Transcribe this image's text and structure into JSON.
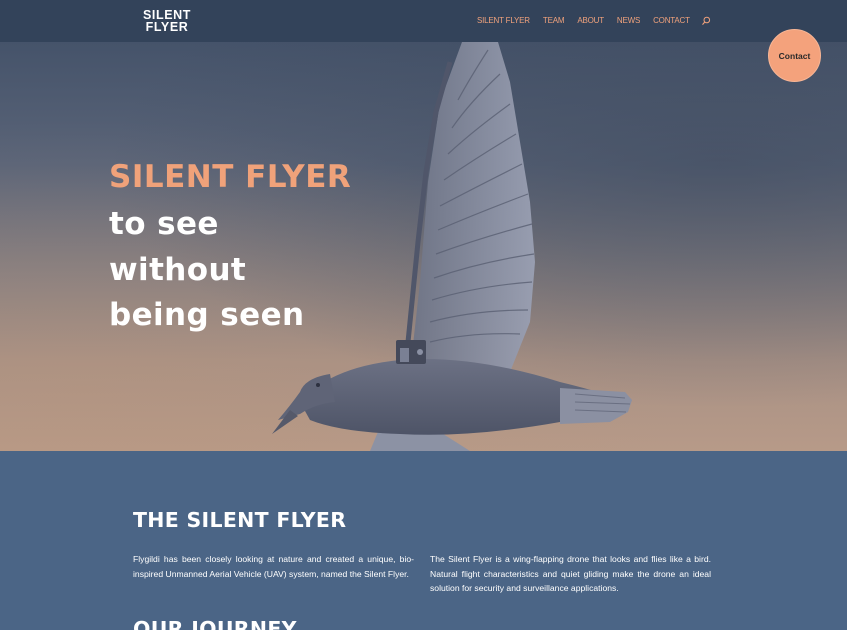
{
  "header": {
    "logo_line1": "SILENT",
    "logo_line2": "FLYER",
    "nav": [
      "SILENT FLYER",
      "TEAM",
      "ABOUT",
      "NEWS",
      "CONTACT"
    ],
    "search_icon": "search-icon"
  },
  "contact_button": {
    "label": "Contact",
    "color": "#f4a27c"
  },
  "hero": {
    "title_accent": "SILENT FLYER",
    "line1": "to see",
    "line2": "without",
    "line3": "being seen",
    "accent_color": "#f0a27a"
  },
  "section": {
    "title": "THE SILENT FLYER",
    "col1": "Flygildi has been closely looking at nature and created a unique, bio-inspired Unmanned Aerial Vehicle (UAV) system, named the Silent Flyer.",
    "col2": "The Silent Flyer is a wing-flapping drone that looks and flies like a bird. Natural flight characteristics and quiet gliding make the drone an ideal solution for security and surveillance applications.",
    "next_title": "OUR JOURNEY",
    "background": "#4b6586"
  }
}
